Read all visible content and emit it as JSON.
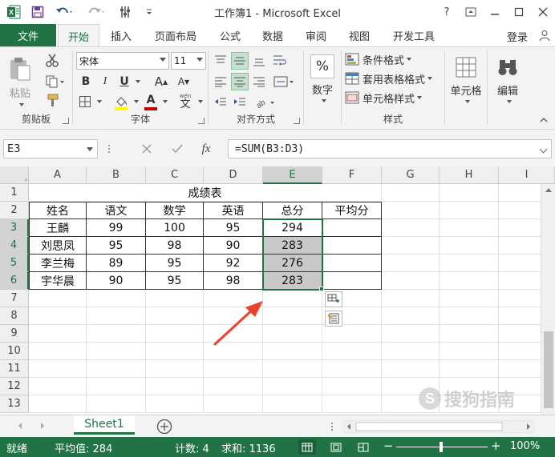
{
  "titlebar": {
    "title": "工作簿1 - Microsoft Excel",
    "app_icon": "excel-icon",
    "help": "?",
    "qat_icons": [
      "save-icon",
      "undo-icon",
      "redo-icon",
      "touch-mode-icon",
      "customize-qat-icon"
    ]
  },
  "tabs": {
    "file": "文件",
    "items": [
      "开始",
      "插入",
      "页面布局",
      "公式",
      "数据",
      "审阅",
      "视图",
      "开发工具"
    ],
    "active": "开始",
    "login": "登录"
  },
  "ribbon": {
    "clipboard": {
      "label": "剪贴板",
      "paste": "粘贴"
    },
    "font": {
      "label": "字体",
      "font_name": "宋体",
      "font_size": "11",
      "bold": "B",
      "italic": "I",
      "underline": "U",
      "grow": "A",
      "shrink": "A",
      "font_color": "A",
      "phonetic": "文"
    },
    "alignment": {
      "label": "对齐方式"
    },
    "number": {
      "label": "数字",
      "icon_text": "%",
      "button": "数字"
    },
    "styles": {
      "label": "样式",
      "items": [
        "条件格式",
        "套用表格格式",
        "单元格样式"
      ]
    },
    "cells": {
      "button": "单元格"
    },
    "editing": {
      "button": "编辑"
    }
  },
  "formula_bar": {
    "name_box": "E3",
    "fx": "fx",
    "formula": "=SUM(B3:D3)"
  },
  "grid": {
    "columns": [
      "A",
      "B",
      "C",
      "D",
      "E",
      "F",
      "G",
      "H",
      "I"
    ],
    "selected_column": "E",
    "rows": [
      "1",
      "2",
      "3",
      "4",
      "5",
      "6",
      "7",
      "8",
      "9",
      "10",
      "11",
      "12",
      "13"
    ],
    "selected_rows": [
      "3",
      "4",
      "5",
      "6"
    ],
    "title_cell": "成绩表",
    "headers": [
      "姓名",
      "语文",
      "数学",
      "英语",
      "总分",
      "平均分"
    ],
    "data": [
      [
        "王麟",
        "99",
        "100",
        "95",
        "294",
        ""
      ],
      [
        "刘思凤",
        "95",
        "98",
        "90",
        "283",
        ""
      ],
      [
        "李兰梅",
        "89",
        "95",
        "92",
        "276",
        ""
      ],
      [
        "宇华晨",
        "90",
        "95",
        "98",
        "283",
        ""
      ]
    ]
  },
  "sheets": {
    "active": "Sheet1",
    "add_icon": "add-sheet-icon"
  },
  "status": {
    "ready": "就绪",
    "average": "平均值: 284",
    "count": "计数: 4",
    "sum": "求和: 1136",
    "zoom": "100%",
    "zoom_minus": "−",
    "zoom_plus": "+"
  },
  "colors": {
    "excel_green": "#217346",
    "selection_fill": "#c8c8c8",
    "ribbon_bg": "#f3f3f3",
    "arrow_red": "#e8412c",
    "font_color_red": "#c00000",
    "highlight_yellow": "#ffff00"
  }
}
